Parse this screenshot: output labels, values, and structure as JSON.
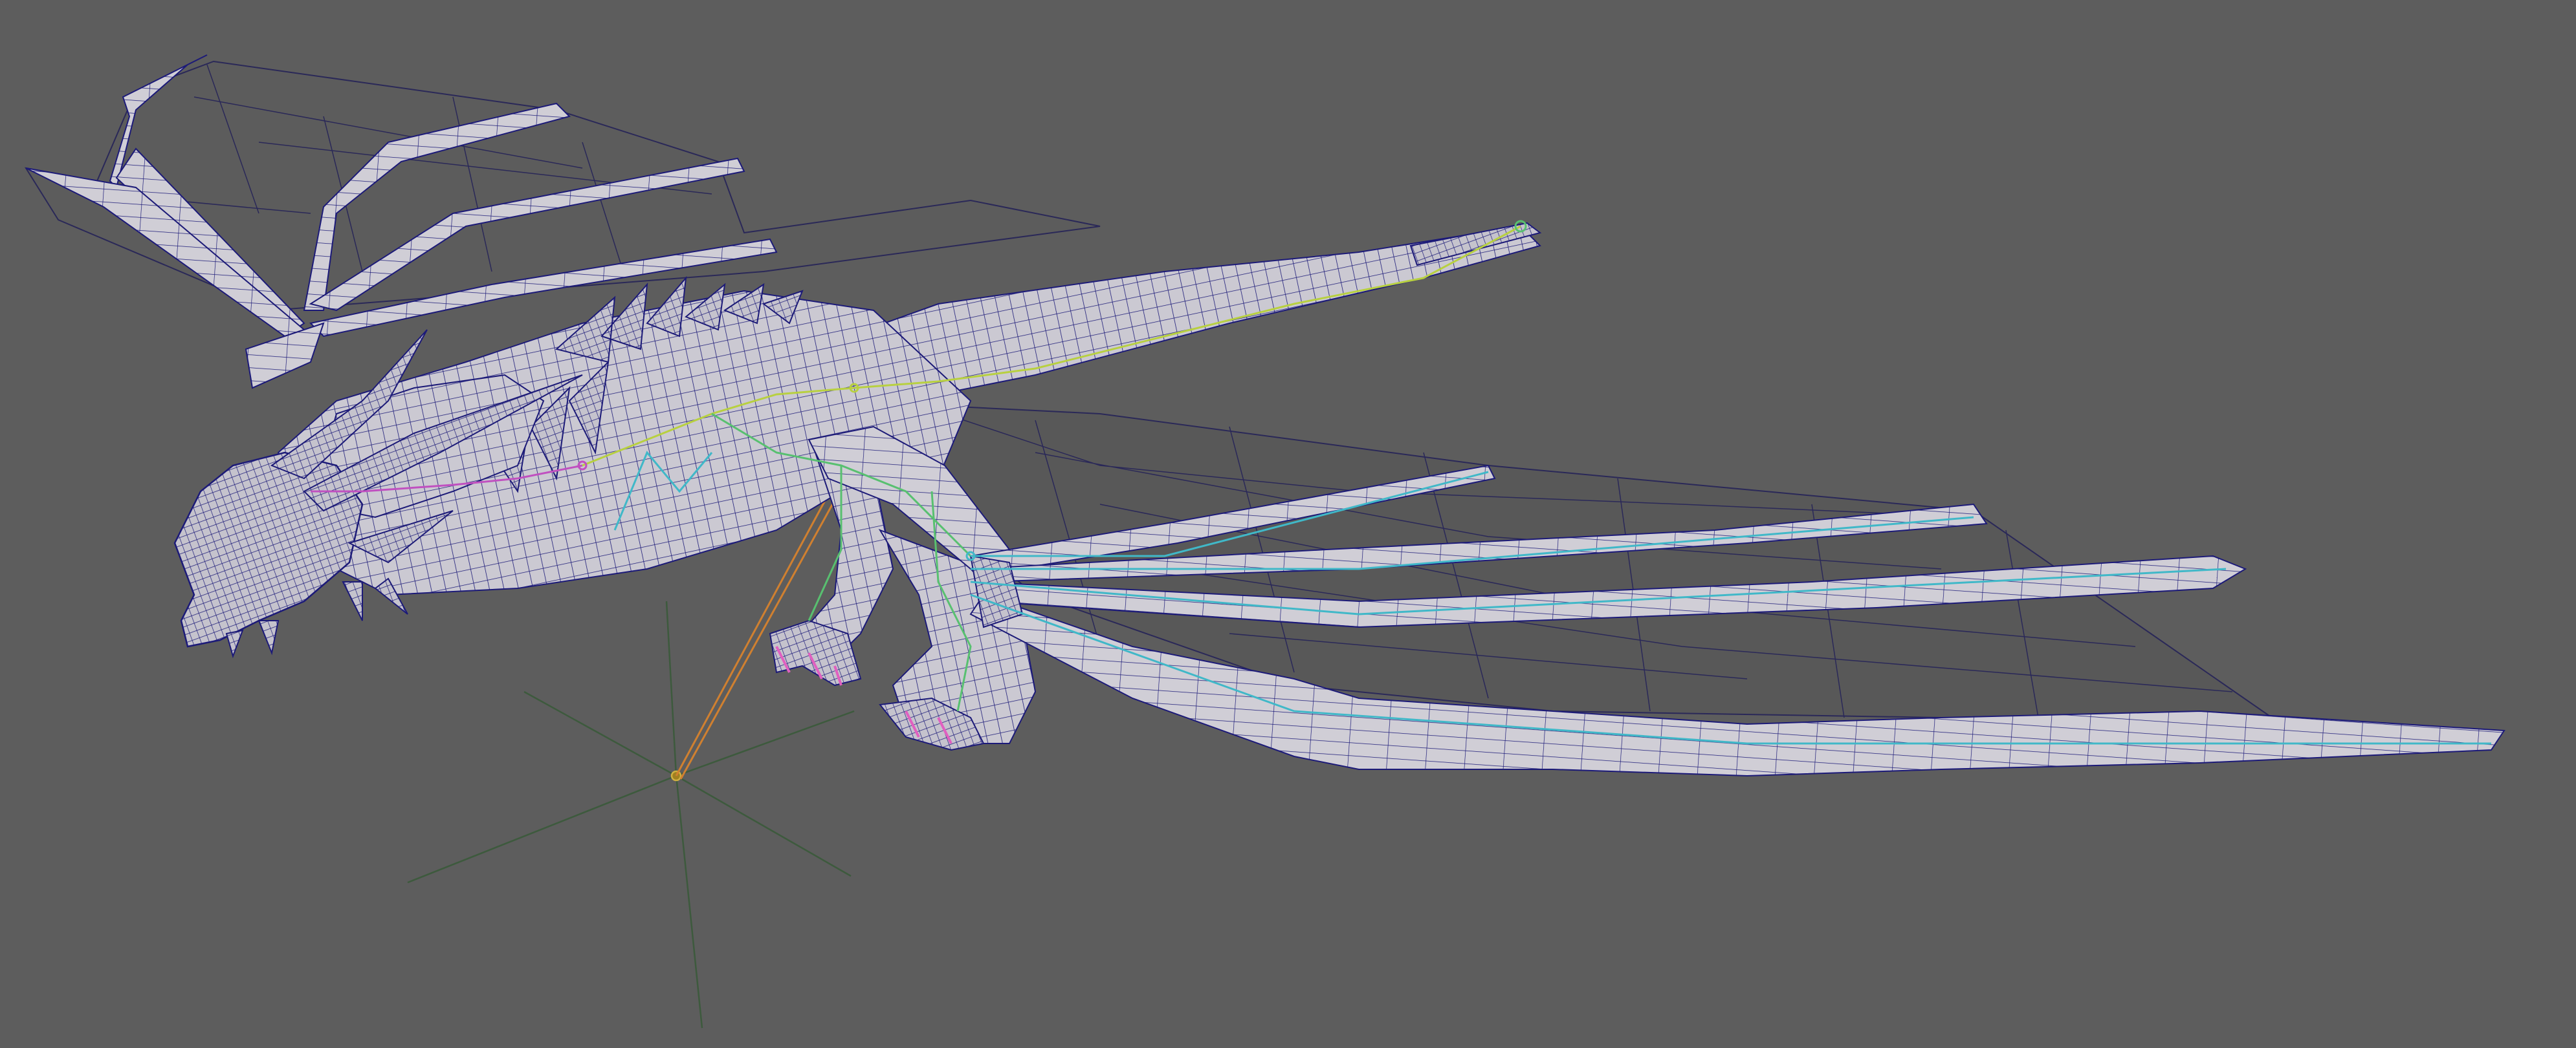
{
  "viewport": {
    "background_color": "#5d5d5d",
    "subject": "dragon-model-wireframe-on-shaded",
    "shading_mode": "wireframe-on-shaded"
  },
  "colors": {
    "mesh_fill": "#cbc9d2",
    "mesh_shadow": "#9f9da8",
    "wire": "#1c1a78",
    "membrane_fill": "#5a5a5a",
    "membrane_dark": "#505050",
    "skeleton_yellow": "#b8d040",
    "skeleton_green": "#58c070",
    "skeleton_cyan": "#40b8c8",
    "skeleton_magenta": "#c050c0",
    "claw_pink": "#e060c0",
    "locator_green": "#3d5a3d",
    "ik_orange": "#d08030"
  },
  "icons": {
    "locator": "locator-cross-icon"
  }
}
